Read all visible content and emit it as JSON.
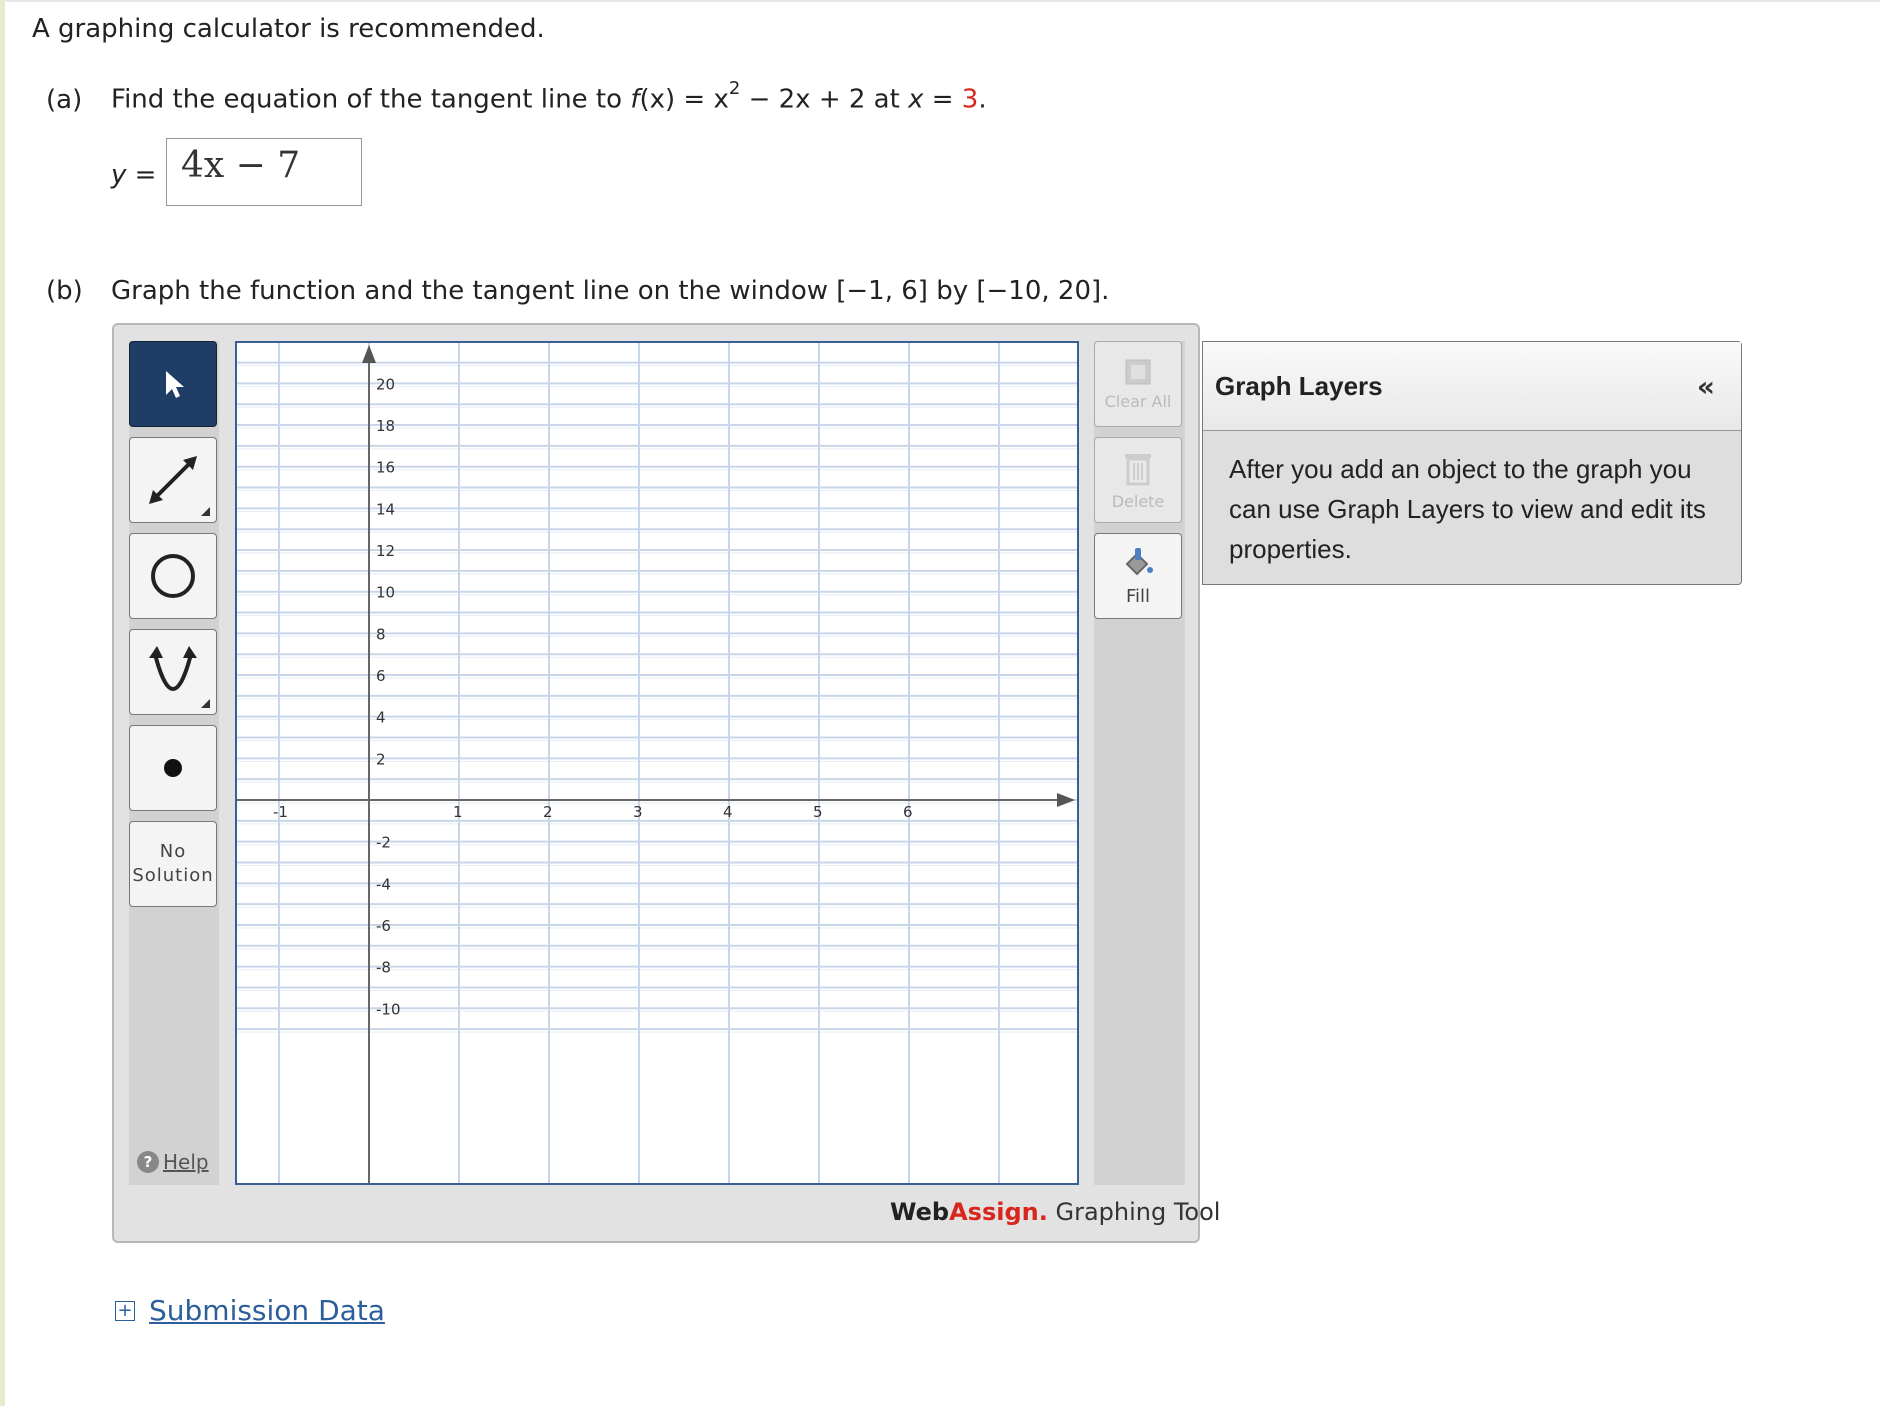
{
  "intro": "A graphing calculator is recommended.",
  "part_a": {
    "label": "(a)",
    "prefix": "Find the equation of the tangent line to ",
    "fn": "f",
    "arg": "(x)",
    "eq": " = x",
    "exp": "2",
    "rest": " − 2x + 2 at ",
    "xvar": "x",
    "eq2": " = ",
    "value": "3",
    "period": "."
  },
  "answer": {
    "label": "y =",
    "value": "4x − 7"
  },
  "part_b": {
    "label": "(b)",
    "text": "Graph the function and the tangent line on the window [−1, 6] by [−10, 20]."
  },
  "tools": {
    "no_solution_1": "No",
    "no_solution_2": "Solution",
    "help": "Help"
  },
  "right_tools": {
    "clear_all": "Clear All",
    "delete": "Delete",
    "fill": "Fill"
  },
  "graph": {
    "x_range": [
      -1,
      6
    ],
    "y_range": [
      -10,
      20
    ],
    "x_labels": [
      "-1",
      "1",
      "2",
      "3",
      "4",
      "5",
      "6"
    ],
    "y_labels": [
      "20",
      "18",
      "16",
      "14",
      "12",
      "10",
      "8",
      "6",
      "4",
      "2",
      "-2",
      "-4",
      "-6",
      "-8",
      "-10"
    ]
  },
  "brand": {
    "web": "Web",
    "assign": "Assign",
    "dot": ".",
    "tail": " Graphing Tool"
  },
  "layers": {
    "title": "Graph Layers",
    "collapse": "«",
    "body": "After you add an object to the graph you can use Graph Layers to view and edit its properties."
  },
  "submission": {
    "plus": "+",
    "link": "Submission Data"
  },
  "colors": {
    "accent_red": "#d9261c",
    "link_blue": "#2b5e9b",
    "grid_border": "#3a5f95",
    "active_tool": "#1f3d66"
  }
}
